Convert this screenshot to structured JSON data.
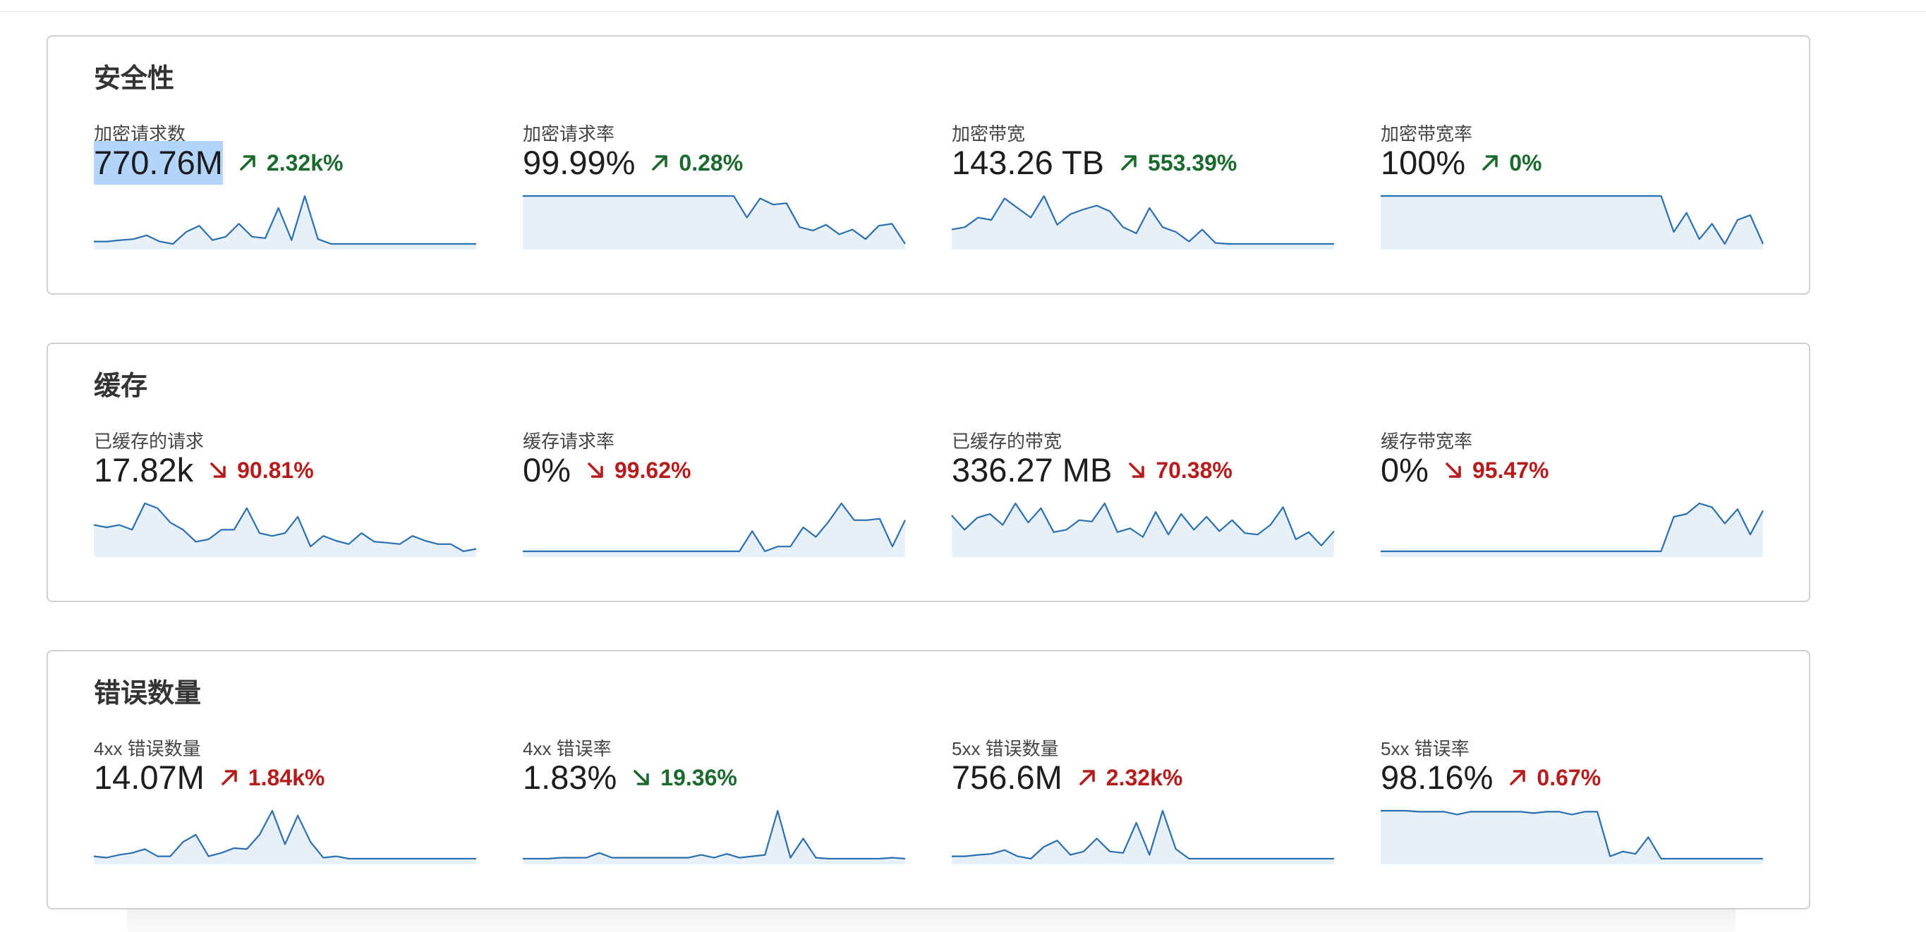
{
  "colors": {
    "line": "#2a6fb0",
    "fill": "#dfeaf6",
    "good": "#1a6a2e",
    "bad": "#b71c1c"
  },
  "sections": [
    {
      "title": "安全性",
      "metrics": [
        {
          "label": "加密请求数",
          "value": "770.76M",
          "delta": "2.32k%",
          "direction": "up",
          "status": "good",
          "selected": true,
          "spark": [
            0.05,
            0.05,
            0.08,
            0.1,
            0.18,
            0.05,
            0.0,
            0.25,
            0.38,
            0.08,
            0.15,
            0.42,
            0.15,
            0.12,
            0.75,
            0.08,
            1.0,
            0.1,
            0.0,
            0.0,
            0.0,
            0.0,
            0.0,
            0.0,
            0.0,
            0.0,
            0.0,
            0.0,
            0.0,
            0.0
          ]
        },
        {
          "label": "加密请求率",
          "value": "99.99%",
          "delta": "0.28%",
          "direction": "up",
          "status": "good",
          "spark": [
            1.0,
            1.0,
            1.0,
            1.0,
            1.0,
            1.0,
            1.0,
            1.0,
            1.0,
            1.0,
            1.0,
            1.0,
            1.0,
            1.0,
            1.0,
            1.0,
            1.0,
            0.55,
            0.95,
            0.82,
            0.85,
            0.35,
            0.28,
            0.4,
            0.2,
            0.3,
            0.1,
            0.38,
            0.42,
            0.0
          ]
        },
        {
          "label": "加密带宽",
          "value": "143.26 TB",
          "delta": "553.39%",
          "direction": "up",
          "status": "good",
          "spark": [
            0.3,
            0.35,
            0.55,
            0.5,
            0.95,
            0.75,
            0.55,
            1.0,
            0.4,
            0.62,
            0.72,
            0.8,
            0.68,
            0.35,
            0.22,
            0.75,
            0.35,
            0.25,
            0.05,
            0.3,
            0.02,
            0.0,
            0.0,
            0.0,
            0.0,
            0.0,
            0.0,
            0.0,
            0.0,
            0.0
          ]
        },
        {
          "label": "加密带宽率",
          "value": "100%",
          "delta": "0%",
          "direction": "up",
          "status": "good",
          "spark": [
            1.0,
            1.0,
            1.0,
            1.0,
            1.0,
            1.0,
            1.0,
            1.0,
            1.0,
            1.0,
            1.0,
            1.0,
            1.0,
            1.0,
            1.0,
            1.0,
            1.0,
            1.0,
            1.0,
            1.0,
            1.0,
            1.0,
            1.0,
            0.25,
            0.65,
            0.1,
            0.42,
            0.0,
            0.5,
            0.6,
            0.0
          ]
        }
      ]
    },
    {
      "title": "缓存",
      "metrics": [
        {
          "label": "已缓存的请求",
          "value": "17.82k",
          "delta": "90.81%",
          "direction": "down",
          "status": "bad",
          "spark": [
            0.55,
            0.5,
            0.55,
            0.45,
            1.0,
            0.9,
            0.6,
            0.45,
            0.2,
            0.25,
            0.45,
            0.45,
            0.9,
            0.38,
            0.32,
            0.38,
            0.72,
            0.1,
            0.32,
            0.22,
            0.15,
            0.38,
            0.2,
            0.18,
            0.15,
            0.32,
            0.22,
            0.15,
            0.15,
            0.0,
            0.05
          ]
        },
        {
          "label": "缓存请求率",
          "value": "0%",
          "delta": "99.62%",
          "direction": "down",
          "status": "bad",
          "spark": [
            0.0,
            0.0,
            0.0,
            0.0,
            0.0,
            0.0,
            0.0,
            0.0,
            0.0,
            0.0,
            0.0,
            0.0,
            0.0,
            0.0,
            0.0,
            0.0,
            0.0,
            0.0,
            0.42,
            0.0,
            0.1,
            0.1,
            0.5,
            0.3,
            0.62,
            1.0,
            0.65,
            0.65,
            0.68,
            0.1,
            0.65
          ]
        },
        {
          "label": "已缓存的带宽",
          "value": "336.27 MB",
          "delta": "70.38%",
          "direction": "down",
          "status": "bad",
          "spark": [
            0.75,
            0.45,
            0.7,
            0.78,
            0.55,
            1.0,
            0.6,
            0.9,
            0.4,
            0.45,
            0.65,
            0.62,
            1.0,
            0.4,
            0.48,
            0.3,
            0.82,
            0.35,
            0.78,
            0.45,
            0.72,
            0.42,
            0.65,
            0.38,
            0.35,
            0.55,
            0.92,
            0.25,
            0.4,
            0.12,
            0.42
          ]
        },
        {
          "label": "缓存带宽率",
          "value": "0%",
          "delta": "95.47%",
          "direction": "down",
          "status": "bad",
          "spark": [
            0.0,
            0.0,
            0.0,
            0.0,
            0.0,
            0.0,
            0.0,
            0.0,
            0.0,
            0.0,
            0.0,
            0.0,
            0.0,
            0.0,
            0.0,
            0.0,
            0.0,
            0.0,
            0.0,
            0.0,
            0.0,
            0.0,
            0.0,
            0.72,
            0.78,
            1.0,
            0.92,
            0.58,
            0.88,
            0.35,
            0.85
          ]
        }
      ]
    },
    {
      "title": "错误数量",
      "metrics": [
        {
          "label": "4xx 错误数量",
          "value": "14.07M",
          "delta": "1.84k%",
          "direction": "up",
          "status": "bad",
          "spark": [
            0.05,
            0.02,
            0.08,
            0.12,
            0.2,
            0.05,
            0.05,
            0.35,
            0.5,
            0.05,
            0.12,
            0.22,
            0.2,
            0.5,
            1.0,
            0.3,
            0.9,
            0.35,
            0.02,
            0.05,
            0.0,
            0.0,
            0.0,
            0.0,
            0.0,
            0.0,
            0.0,
            0.0,
            0.0,
            0.0,
            0.0
          ]
        },
        {
          "label": "4xx 错误率",
          "value": "1.83%",
          "delta": "19.36%",
          "direction": "down",
          "status": "good",
          "spark": [
            0.0,
            0.0,
            0.0,
            0.02,
            0.02,
            0.02,
            0.12,
            0.02,
            0.02,
            0.02,
            0.02,
            0.02,
            0.02,
            0.02,
            0.08,
            0.02,
            0.1,
            0.02,
            0.05,
            0.08,
            1.0,
            0.02,
            0.42,
            0.02,
            0.0,
            0.0,
            0.0,
            0.0,
            0.0,
            0.02,
            0.0
          ]
        },
        {
          "label": "5xx 错误数量",
          "value": "756.6M",
          "delta": "2.32k%",
          "direction": "up",
          "status": "bad",
          "spark": [
            0.05,
            0.05,
            0.08,
            0.1,
            0.18,
            0.05,
            0.0,
            0.25,
            0.38,
            0.08,
            0.15,
            0.42,
            0.15,
            0.12,
            0.75,
            0.08,
            1.0,
            0.2,
            0.0,
            0.0,
            0.0,
            0.0,
            0.0,
            0.0,
            0.0,
            0.0,
            0.0,
            0.0,
            0.0,
            0.0
          ]
        },
        {
          "label": "5xx 错误率",
          "value": "98.16%",
          "delta": "0.67%",
          "direction": "up",
          "status": "bad",
          "spark": [
            1.0,
            1.0,
            1.0,
            0.98,
            0.98,
            0.98,
            0.92,
            0.98,
            0.98,
            0.98,
            0.98,
            0.98,
            0.95,
            0.98,
            0.98,
            0.92,
            0.98,
            0.98,
            0.05,
            0.15,
            0.1,
            0.45,
            0.0,
            0.0,
            0.0,
            0.0,
            0.0,
            0.0,
            0.0,
            0.0,
            0.0
          ]
        }
      ]
    }
  ]
}
